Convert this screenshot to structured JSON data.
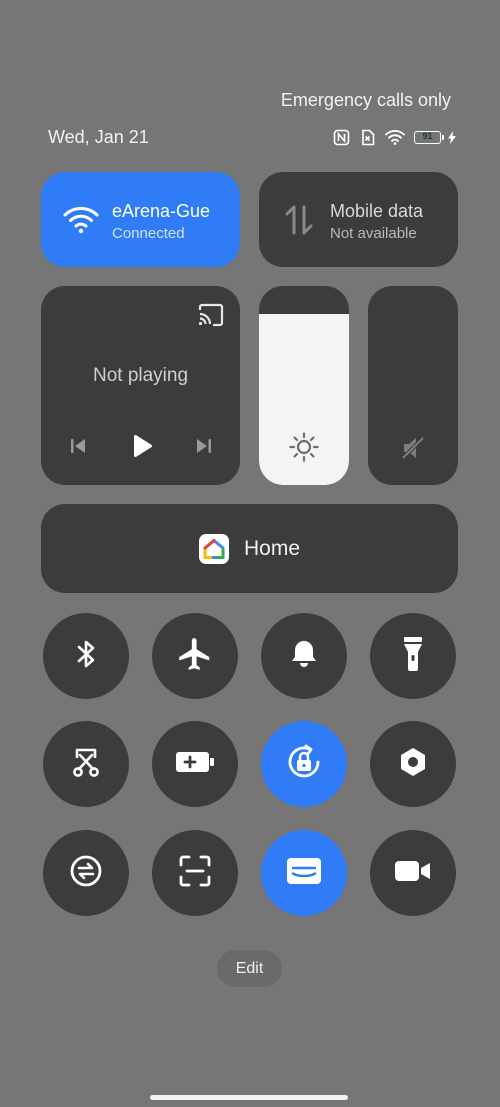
{
  "status_bar": {
    "carrier_text": "Emergency calls only",
    "date": "Wed, Jan 21",
    "battery_level": "91",
    "icons": [
      "nfc-icon",
      "no-sim-icon",
      "wifi-icon",
      "battery-icon",
      "charging-icon"
    ]
  },
  "tiles": {
    "wifi": {
      "title": "eArena-Gue",
      "subtitle": "Connected",
      "active": true
    },
    "mobile_data": {
      "title": "Mobile data",
      "subtitle": "Not available",
      "active": false
    }
  },
  "media": {
    "status": "Not playing"
  },
  "brightness_level": 0.86,
  "home": {
    "label": "Home"
  },
  "toggles": [
    {
      "name": "bluetooth",
      "icon": "bluetooth-icon",
      "active": false
    },
    {
      "name": "airplane-mode",
      "icon": "airplane-icon",
      "active": false
    },
    {
      "name": "ringer",
      "icon": "bell-icon",
      "active": false
    },
    {
      "name": "flashlight",
      "icon": "flashlight-icon",
      "active": false
    },
    {
      "name": "screenshot",
      "icon": "scissors-icon",
      "active": false
    },
    {
      "name": "battery-saver",
      "icon": "battery-saver-icon",
      "active": false
    },
    {
      "name": "rotation-lock",
      "icon": "rotation-lock-icon",
      "active": true
    },
    {
      "name": "settings-shortcut",
      "icon": "hexagon-icon",
      "active": false
    },
    {
      "name": "data-sync",
      "icon": "sync-icon",
      "active": false
    },
    {
      "name": "scanner",
      "icon": "scan-icon",
      "active": false
    },
    {
      "name": "wallet",
      "icon": "wallet-icon",
      "active": true
    },
    {
      "name": "screen-recorder",
      "icon": "video-icon",
      "active": false
    }
  ],
  "edit_label": "Edit",
  "colors": {
    "accent": "#2f7cf6",
    "tile_bg": "#3c3c3c",
    "background": "#767676"
  }
}
